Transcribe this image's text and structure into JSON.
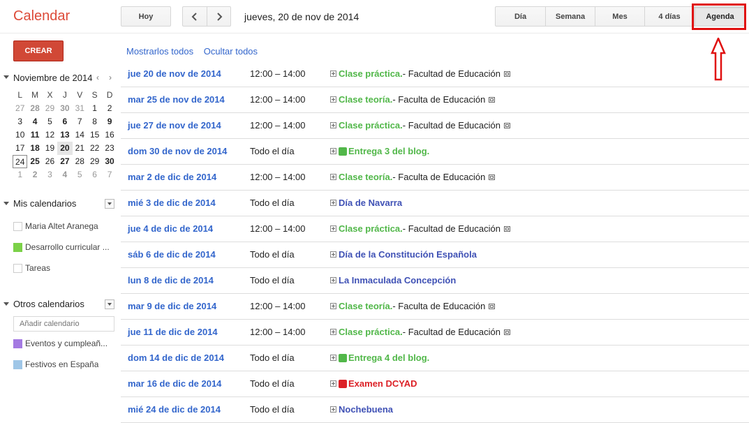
{
  "header": {
    "app_title": "Calendar",
    "today_label": "Hoy",
    "date_range": "jueves, 20 de nov de 2014",
    "views": [
      {
        "label": "Día",
        "active": false
      },
      {
        "label": "Semana",
        "active": false
      },
      {
        "label": "Mes",
        "active": false
      },
      {
        "label": "4 días",
        "active": false
      },
      {
        "label": "Agenda",
        "active": true
      }
    ]
  },
  "sidebar": {
    "create_label": "CREAR",
    "mini_calendar": {
      "month_label": "Noviembre de 2014",
      "prev": "‹",
      "next": "›",
      "weekdays": [
        "L",
        "M",
        "X",
        "J",
        "V",
        "S",
        "D"
      ],
      "weeks": [
        [
          {
            "d": "27",
            "s": "other"
          },
          {
            "d": "28",
            "s": "other-bold"
          },
          {
            "d": "29",
            "s": "other"
          },
          {
            "d": "30",
            "s": "other-bold"
          },
          {
            "d": "31",
            "s": "other"
          },
          {
            "d": "1",
            "s": ""
          },
          {
            "d": "2",
            "s": ""
          }
        ],
        [
          {
            "d": "3",
            "s": ""
          },
          {
            "d": "4",
            "s": "bold"
          },
          {
            "d": "5",
            "s": ""
          },
          {
            "d": "6",
            "s": "bold"
          },
          {
            "d": "7",
            "s": ""
          },
          {
            "d": "8",
            "s": ""
          },
          {
            "d": "9",
            "s": "bold"
          }
        ],
        [
          {
            "d": "10",
            "s": ""
          },
          {
            "d": "11",
            "s": "bold"
          },
          {
            "d": "12",
            "s": ""
          },
          {
            "d": "13",
            "s": "bold"
          },
          {
            "d": "14",
            "s": ""
          },
          {
            "d": "15",
            "s": ""
          },
          {
            "d": "16",
            "s": ""
          }
        ],
        [
          {
            "d": "17",
            "s": ""
          },
          {
            "d": "18",
            "s": "bold"
          },
          {
            "d": "19",
            "s": ""
          },
          {
            "d": "20",
            "s": "today"
          },
          {
            "d": "21",
            "s": ""
          },
          {
            "d": "22",
            "s": ""
          },
          {
            "d": "23",
            "s": ""
          }
        ],
        [
          {
            "d": "24",
            "s": "boxed"
          },
          {
            "d": "25",
            "s": "bold"
          },
          {
            "d": "26",
            "s": ""
          },
          {
            "d": "27",
            "s": "bold"
          },
          {
            "d": "28",
            "s": ""
          },
          {
            "d": "29",
            "s": ""
          },
          {
            "d": "30",
            "s": "bold"
          }
        ],
        [
          {
            "d": "1",
            "s": "other"
          },
          {
            "d": "2",
            "s": "other-bold"
          },
          {
            "d": "3",
            "s": "other"
          },
          {
            "d": "4",
            "s": "other-bold"
          },
          {
            "d": "5",
            "s": "other"
          },
          {
            "d": "6",
            "s": "other"
          },
          {
            "d": "7",
            "s": "other"
          }
        ]
      ]
    },
    "my_calendars": {
      "title": "Mis calendarios",
      "items": [
        {
          "label": "Maria Altet Aranega",
          "color": "#ffffff"
        },
        {
          "label": "Desarrollo curricular ...",
          "color": "#7bd148"
        },
        {
          "label": "Tareas",
          "color": "#ffffff"
        }
      ]
    },
    "other_calendars": {
      "title": "Otros calendarios",
      "add_placeholder": "Añadir calendario",
      "items": [
        {
          "label": "Eventos y cumpleañ...",
          "color": "#a47ae2"
        },
        {
          "label": "Festivos en España",
          "color": "#9fc6e7"
        }
      ]
    }
  },
  "main": {
    "show_all": "Mostrarlos todos",
    "hide_all": "Ocultar todos",
    "colors": {
      "green": "#51b749",
      "blue": "#3f51b5",
      "red": "#dc2127",
      "link": "#3366cc"
    },
    "agenda": [
      {
        "date": "jue 20 de nov de 2014",
        "time": "12:00 – 14:00",
        "title": "Clase práctica.",
        "location": " - Facultad de Educación",
        "color": "green",
        "swatch": false,
        "ext": true
      },
      {
        "date": "mar 25 de nov de 2014",
        "time": "12:00 – 14:00",
        "title": "Clase teoría.",
        "location": " - Faculta de Educación",
        "color": "green",
        "swatch": false,
        "ext": true
      },
      {
        "date": "jue 27 de nov de 2014",
        "time": "12:00 – 14:00",
        "title": "Clase práctica.",
        "location": " - Facultad de Educación",
        "color": "green",
        "swatch": false,
        "ext": true
      },
      {
        "date": "dom 30 de nov de 2014",
        "time": "Todo el día",
        "title": "Entrega 3 del blog.",
        "location": "",
        "color": "green",
        "swatch": true,
        "ext": false
      },
      {
        "date": "mar 2 de dic de 2014",
        "time": "12:00 – 14:00",
        "title": "Clase teoría.",
        "location": " - Faculta de Educación",
        "color": "green",
        "swatch": false,
        "ext": true
      },
      {
        "date": "mié 3 de dic de 2014",
        "time": "Todo el día",
        "title": "Día de Navarra",
        "location": "",
        "color": "blue",
        "swatch": false,
        "ext": false
      },
      {
        "date": "jue 4 de dic de 2014",
        "time": "12:00 – 14:00",
        "title": "Clase práctica.",
        "location": " - Facultad de Educación",
        "color": "green",
        "swatch": false,
        "ext": true
      },
      {
        "date": "sáb 6 de dic de 2014",
        "time": "Todo el día",
        "title": "Día de la Constitución Española",
        "location": "",
        "color": "blue",
        "swatch": false,
        "ext": false
      },
      {
        "date": "lun 8 de dic de 2014",
        "time": "Todo el día",
        "title": "La Inmaculada Concepción",
        "location": "",
        "color": "blue",
        "swatch": false,
        "ext": false
      },
      {
        "date": "mar 9 de dic de 2014",
        "time": "12:00 – 14:00",
        "title": "Clase teoría.",
        "location": " - Faculta de Educación",
        "color": "green",
        "swatch": false,
        "ext": true
      },
      {
        "date": "jue 11 de dic de 2014",
        "time": "12:00 – 14:00",
        "title": "Clase práctica.",
        "location": " - Facultad de Educación",
        "color": "green",
        "swatch": false,
        "ext": true
      },
      {
        "date": "dom 14 de dic de 2014",
        "time": "Todo el día",
        "title": "Entrega 4 del blog.",
        "location": "",
        "color": "green",
        "swatch": true,
        "ext": false
      },
      {
        "date": "mar 16 de dic de 2014",
        "time": "Todo el día",
        "title": "Examen DCYAD",
        "location": "",
        "color": "red",
        "swatch": true,
        "ext": false
      },
      {
        "date": "mié 24 de dic de 2014",
        "time": "Todo el día",
        "title": "Nochebuena",
        "location": "",
        "color": "blue",
        "swatch": false,
        "ext": false
      }
    ]
  }
}
